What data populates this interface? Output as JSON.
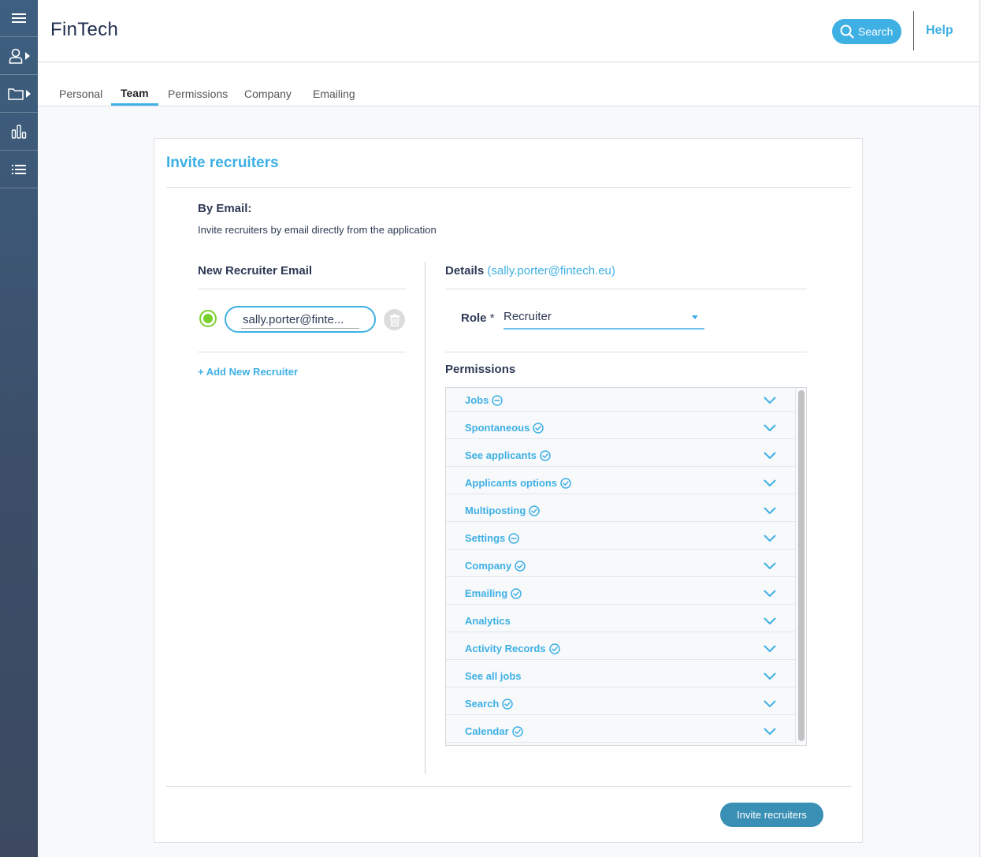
{
  "sidebar": {
    "items": [
      {
        "icon": "hamburger-menu-icon"
      },
      {
        "icon": "user-icon",
        "has_submenu": true
      },
      {
        "icon": "folder-icon",
        "has_submenu": true
      },
      {
        "icon": "bar-chart-icon"
      },
      {
        "icon": "list-icon"
      }
    ]
  },
  "header": {
    "title": "FinTech",
    "search_label": "Search",
    "help_label": "Help"
  },
  "tabs": [
    {
      "label": "Personal",
      "active": false
    },
    {
      "label": "Team",
      "active": true
    },
    {
      "label": "Permissions",
      "active": false
    },
    {
      "label": "Company",
      "active": false
    },
    {
      "label": "Emailing",
      "active": false
    }
  ],
  "card": {
    "title": "Invite recruiters",
    "by_email_title": "By Email:",
    "by_email_desc": "Invite recruiters by email directly from the application",
    "left": {
      "title": "New Recruiter Email",
      "email_value": "sally.porter@fintech.eu",
      "email_display": "sally.porter@finte...",
      "add_label": "+ Add New Recruiter"
    },
    "right": {
      "details_label": "Details",
      "details_email": "(sally.porter@fintech.eu)",
      "role_label": "Role",
      "role_required": "*",
      "role_value": "Recruiter",
      "permissions_title": "Permissions",
      "permissions": [
        {
          "label": "Jobs",
          "status": "partial"
        },
        {
          "label": "Spontaneous",
          "status": "full"
        },
        {
          "label": "See applicants",
          "status": "full"
        },
        {
          "label": "Applicants options",
          "status": "full"
        },
        {
          "label": "Multiposting",
          "status": "full"
        },
        {
          "label": "Settings",
          "status": "partial"
        },
        {
          "label": "Company",
          "status": "full"
        },
        {
          "label": "Emailing",
          "status": "full"
        },
        {
          "label": "Analytics",
          "status": "none"
        },
        {
          "label": "Activity Records",
          "status": "full"
        },
        {
          "label": "See all jobs",
          "status": "none"
        },
        {
          "label": "Search",
          "status": "full"
        },
        {
          "label": "Calendar",
          "status": "full"
        }
      ]
    },
    "submit_label": "Invite recruiters"
  },
  "colors": {
    "accent": "#3eb0e4",
    "sidebar": "#3c5576",
    "success": "#7ad12e",
    "primary_button": "#3a8fb5"
  }
}
